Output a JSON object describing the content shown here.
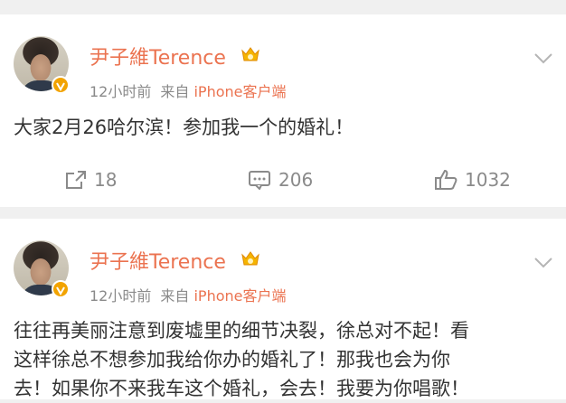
{
  "posts": [
    {
      "author": "尹子維Terence",
      "time": "12小时前",
      "source_prefix": "来自",
      "device": "iPhone客户端",
      "text": "大家2月26哈尔滨！参加我一个的婚礼！",
      "reposts": "18",
      "comments": "206",
      "likes": "1032"
    },
    {
      "author": "尹子維Terence",
      "time": "12小时前",
      "source_prefix": "来自",
      "device": "iPhone客户端",
      "lines": [
        "往往再美丽注意到废墟里的细节决裂，徐总对不起！看",
        "这样徐总不想参加我给你办的婚礼了！那我也会为你",
        "去！如果你不来我车这个婚礼，会去！我要为你唱歌！"
      ]
    }
  ],
  "colors": {
    "name": "#eb7350",
    "muted": "#8a8a8a",
    "badge": "#f2a300",
    "background": "#f0f0f0"
  },
  "icons": [
    "avatar",
    "verified-badge-icon",
    "crown-icon",
    "chevron-down-icon",
    "repost-icon",
    "comment-icon",
    "like-icon"
  ]
}
